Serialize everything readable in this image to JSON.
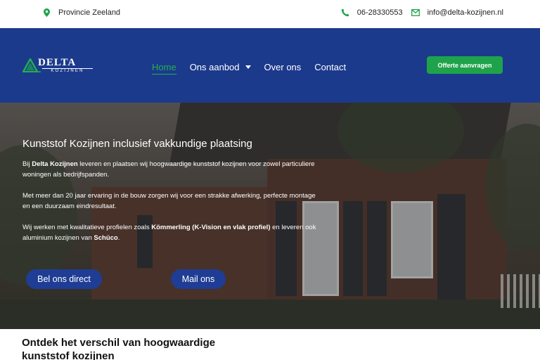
{
  "topbar": {
    "location": "Provincie Zeeland",
    "phone": "06-28330553",
    "email": "info@delta-kozijnen.nl"
  },
  "logo": {
    "brand": "DELTA",
    "sub": "KOZIJNEN"
  },
  "nav": {
    "items": [
      {
        "label": "Home"
      },
      {
        "label": "Ons aanbod"
      },
      {
        "label": "Over ons"
      },
      {
        "label": "Contact"
      }
    ],
    "cta": "Offerte aanvragen"
  },
  "hero": {
    "title": "Kunststof Kozijnen inclusief vakkundige plaatsing",
    "p1_pre": "Bij ",
    "p1_bold": "Delta Kozijnen",
    "p1_post": " leveren en plaatsen wij hoogwaardige kunststof kozijnen voor zowel particuliere woningen als bedrijfspanden.",
    "p2": "Met meer dan 20 jaar ervaring in de bouw zorgen wij voor een strakke afwerking, perfecte montage en een duurzaam eindresultaat.",
    "p3_pre": "Wij werken met kwalitatieve profielen zoals ",
    "p3_bold1": "Kömmerling (K-Vision en vlak profiel)",
    "p3_mid": " en leveren ook aluminium kozijnen van ",
    "p3_bold2": "Schüco",
    "p3_post": ".",
    "button_call": "Bel ons direct",
    "button_mail": "Mail ons"
  },
  "section": {
    "title": "Ontdek het verschil van hoogwaardige kunststof kozijnen"
  },
  "colors": {
    "nav_bg": "#1c3a8c",
    "accent_green": "#1ea34a",
    "button_blue": "#1f3d94"
  }
}
